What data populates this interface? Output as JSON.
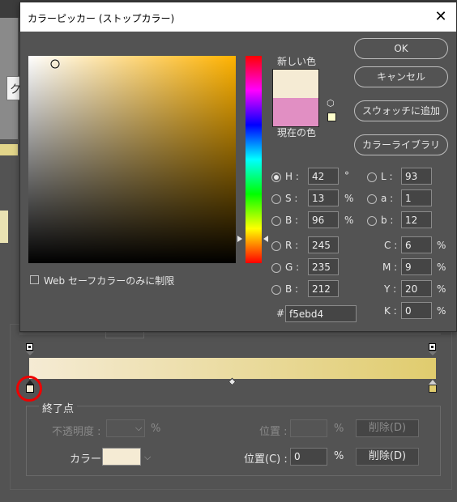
{
  "dialog": {
    "title": "カラーピッカー (ストップカラー)",
    "close_glyph": "✕",
    "new_label": "新しい色",
    "current_label": "現在の色",
    "new_color": "#f5ebd4",
    "current_color": "#e18fc3",
    "web_swatch_color": "#ffffcc",
    "buttons": {
      "ok": "OK",
      "cancel": "キャンセル",
      "add_to_swatches": "スウォッチに追加",
      "color_libraries": "カラーライブラリ"
    },
    "hsb": {
      "h": {
        "label": "H :",
        "value": "42",
        "unit": "°",
        "selected": true
      },
      "s": {
        "label": "S :",
        "value": "13",
        "unit": "%"
      },
      "b": {
        "label": "B :",
        "value": "96",
        "unit": "%"
      }
    },
    "lab": {
      "l": {
        "label": "L :",
        "value": "93"
      },
      "a": {
        "label": "a :",
        "value": "1"
      },
      "b": {
        "label": "b :",
        "value": "12"
      }
    },
    "rgb": {
      "r": {
        "label": "R :",
        "value": "245"
      },
      "g": {
        "label": "G :",
        "value": "235"
      },
      "b": {
        "label": "B :",
        "value": "212"
      }
    },
    "cmyk": {
      "c": {
        "label": "C :",
        "value": "6",
        "unit": "%"
      },
      "m": {
        "label": "M :",
        "value": "9",
        "unit": "%"
      },
      "y": {
        "label": "Y :",
        "value": "20",
        "unit": "%"
      },
      "k": {
        "label": "K :",
        "value": "0",
        "unit": "%"
      }
    },
    "hex": {
      "label": "#",
      "value": "f5ebd4"
    },
    "web_only_label": "Web セーフカラーのみに制限",
    "hue_degrees": 42,
    "saturation": 0.13,
    "brightness": 0.96
  },
  "gradient_editor": {
    "start_color": "#f5ebd4",
    "end_color": "#e0cc6e",
    "stops_legend": "終了点",
    "opacity_label": "不透明度 :",
    "opacity_unit": "%",
    "location_label_top": "位置 :",
    "location_unit_top": "%",
    "delete_label_top": "削除(D)",
    "color_label": "カラー :",
    "location_label": "位置(C) :",
    "location_value": "0",
    "location_unit": "%",
    "delete_label": "削除(D)"
  }
}
